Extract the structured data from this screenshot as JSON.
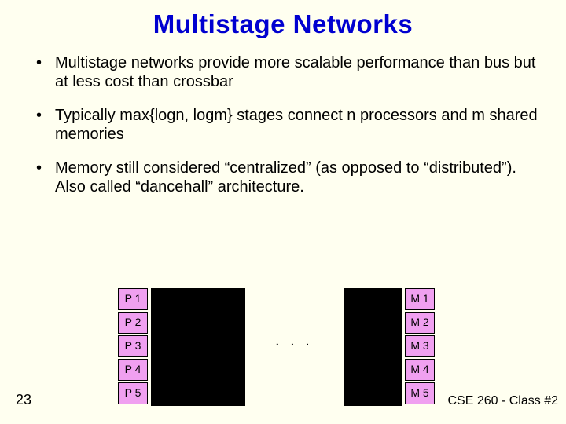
{
  "title": "Multistage Networks",
  "bullets": [
    "Multistage networks provide more scalable performance than bus but at less cost than crossbar",
    "Typically max{logn, logm} stages connect n processors and m shared memories",
    "Memory still considered “centralized” (as opposed to “distributed”). Also called “dancehall” architecture."
  ],
  "diagram": {
    "processors": [
      "P 1",
      "P 2",
      "P 3",
      "P 4",
      "P 5"
    ],
    "memories": [
      "M 1",
      "M 2",
      "M 3",
      "M 4",
      "M 5"
    ],
    "ellipsis": ". . .",
    "box_fill": "#f0a0f0"
  },
  "slide_number": "23",
  "footer": "CSE 260 - Class #2"
}
